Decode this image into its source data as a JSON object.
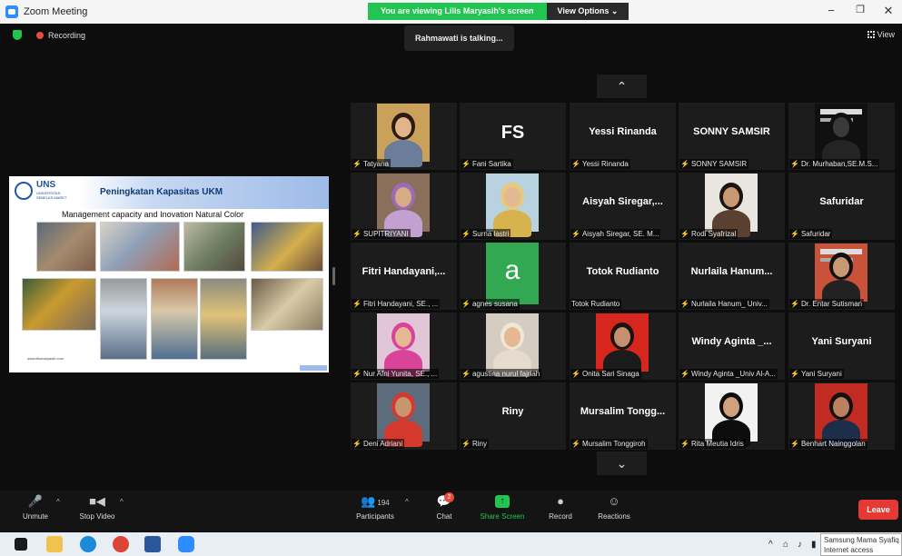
{
  "window": {
    "title": "Zoom Meeting"
  },
  "share_banner": {
    "message": "You are viewing Lilis Maryasih's screen",
    "options_label": "View Options ⌄"
  },
  "status": {
    "recording": "Recording",
    "talking": "Rahmawati is talking...",
    "view": "View"
  },
  "slide": {
    "brand": "UNS",
    "brand_sub": "UNIVERSITAS SEBELAS MARET",
    "title": "Peningkatan Kapasitas UKM",
    "subtitle": "Management capacity and Inovation Natural Color",
    "footer": "www.lilismaryasih.com"
  },
  "gallery": {
    "scroll_up": "⌃",
    "scroll_down": "⌄",
    "tiles": [
      {
        "kind": "video",
        "label": "Tatyana"
      },
      {
        "kind": "initials",
        "initials": "FS",
        "label": "Fani Sartika"
      },
      {
        "kind": "name",
        "name": "Yessi Rinanda",
        "label": "Yessi Rinanda"
      },
      {
        "kind": "name",
        "name": "SONNY SAMSIR",
        "label": "SONNY SAMSIR"
      },
      {
        "kind": "video",
        "label": "Dr. Murhaban,SE.M.S..."
      },
      {
        "kind": "video",
        "label": "SUPITRIYANI"
      },
      {
        "kind": "video",
        "label": "Surna lastri"
      },
      {
        "kind": "name",
        "name": "Aisyah Siregar,...",
        "label": "Aisyah Siregar, SE. M..."
      },
      {
        "kind": "video",
        "label": "Rodi Syafrizal"
      },
      {
        "kind": "name",
        "name": "Safuridar",
        "label": "Safuridar"
      },
      {
        "kind": "name",
        "name": "Fitri Handayani,...",
        "label": "Fitri Handayani, SE., ..."
      },
      {
        "kind": "letter",
        "letter": "a",
        "label": "agnes susana"
      },
      {
        "kind": "name",
        "name": "Totok Rudianto",
        "label": "Totok Rudianto"
      },
      {
        "kind": "name",
        "name": "Nurlaila Hanum...",
        "label": "Nurlaila Hanum_ Univ..."
      },
      {
        "kind": "video",
        "label": "Dr. Entar Sutisman"
      },
      {
        "kind": "video",
        "label": "Nur Afni Yunita, SE., ..."
      },
      {
        "kind": "video",
        "label": "agustina nurul fajriah"
      },
      {
        "kind": "video",
        "label": "Onita Sari Sinaga"
      },
      {
        "kind": "name",
        "name": "Windy Aginta _...",
        "label": "Windy Aginta _Univ Al-A..."
      },
      {
        "kind": "name",
        "name": "Yani Suryani",
        "label": "Yani Suryani"
      },
      {
        "kind": "video",
        "label": "Deni Adriani"
      },
      {
        "kind": "name",
        "name": "Riny",
        "label": "Riny"
      },
      {
        "kind": "name",
        "name": "Mursalim Tongg...",
        "label": "Mursalim Tonggiroh"
      },
      {
        "kind": "video",
        "label": "Rita Meutia Idris"
      },
      {
        "kind": "video",
        "label": "Benhart Nainggolan"
      }
    ]
  },
  "toolbar": {
    "unmute": "Unmute",
    "stop_video": "Stop Video",
    "participants": "Participants",
    "participants_count": "194",
    "chat": "Chat",
    "chat_badge": "2",
    "share_screen": "Share Screen",
    "record": "Record",
    "reactions": "Reactions",
    "leave": "Leave"
  },
  "taskbar": {
    "notification_title": "Samsung Mama Syafiq",
    "notification_body": "Internet access"
  },
  "colors": {
    "accent_green": "#23c552",
    "leave_red": "#e53935",
    "muted_red": "#e03a3a",
    "zoom_blue": "#2d8cff"
  }
}
